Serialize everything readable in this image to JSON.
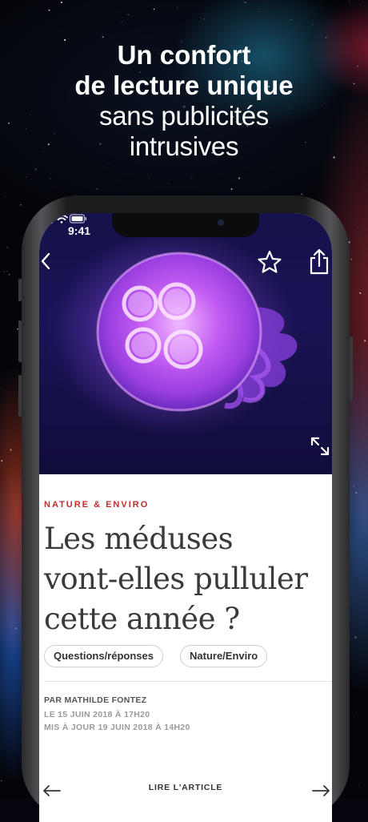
{
  "headline": {
    "line1": "Un confort",
    "line2": "de lecture unique",
    "line3": "sans publicités",
    "line4": "intrusives"
  },
  "status_bar": {
    "time": "9:41"
  },
  "toolbar": {
    "back_icon": "chevron-left-icon",
    "favorite_icon": "star-icon",
    "share_icon": "share-icon",
    "expand_icon": "expand-icon"
  },
  "article": {
    "section": "NATURE & ENVIRO",
    "title_line1": "Les méduses",
    "title_line2": "vont-elles pulluler",
    "title_line3": "cette année ?",
    "tags": [
      "Questions/réponses",
      "Nature/Enviro"
    ],
    "author": "PAR MATHILDE FONTEZ",
    "published": "LE 15 JUIN 2018 À 17H20",
    "updated": "MIS À JOUR 19 JUIN 2018 À 14H20"
  },
  "footer_nav": {
    "read_label": "LIRE L'ARTICLE",
    "prev_icon": "arrow-left-icon",
    "next_icon": "arrow-right-icon"
  },
  "colors": {
    "section_accent": "#c42b2b",
    "hero_background": "#1a1456",
    "jellyfish": "#b24ff0"
  }
}
